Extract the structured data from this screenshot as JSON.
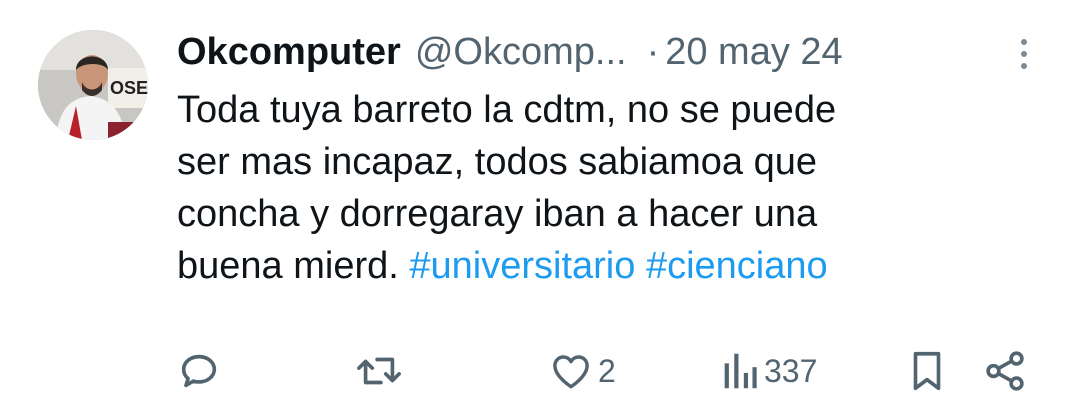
{
  "tweet": {
    "display_name": "Okcomputer",
    "handle": "@Okcomp...",
    "separator": "·",
    "date": "20 may 24",
    "text_line1": "Toda tuya barreto la cdtm, no se puede",
    "text_line2": "ser mas incapaz, todos sabiamoa que",
    "text_line3": "concha y dorregaray iban a hacer una",
    "text_line4_prefix": "buena mierd.",
    "hashtags": [
      "#universitario",
      "#cienciano"
    ]
  },
  "avatar": {
    "sign_text": "OSE"
  },
  "actions": {
    "reply_icon": "reply-icon",
    "retweet_icon": "retweet-icon",
    "like_icon": "heart-icon",
    "like_count": "2",
    "views_icon": "views-bar-chart-icon",
    "views_count": "337",
    "bookmark_icon": "bookmark-icon",
    "share_icon": "share-icon"
  },
  "colors": {
    "text": "#0f1419",
    "secondary": "#536471",
    "hashtag": "#1d9bf0",
    "background": "#ffffff"
  }
}
